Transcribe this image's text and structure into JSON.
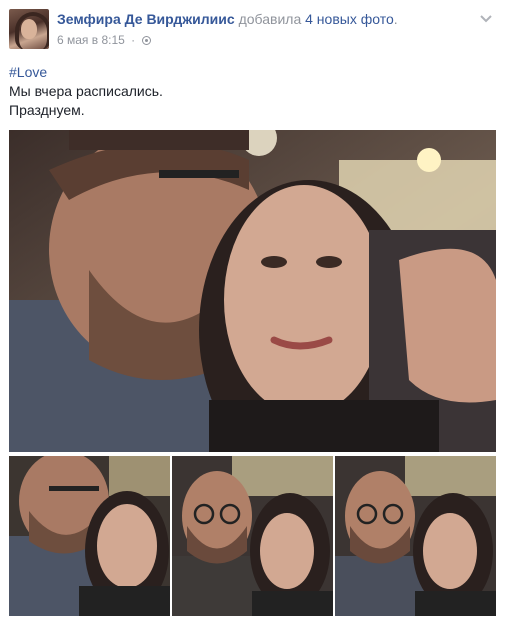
{
  "post": {
    "author": "Земфира Де Вирджилиис",
    "action": "добавила",
    "action_link": "4 новых фото",
    "action_end": ".",
    "date": "6 мая в 8:15",
    "separator": "·",
    "privacy_icon": "globe-icon",
    "menu_icon": "chevron-down-icon",
    "hashtag": "#Love",
    "lines": [
      "Мы вчера расписались.",
      "Празднуем."
    ]
  },
  "photos": {
    "count_label": "4 новых фото",
    "items": [
      "main-photo",
      "thumb-1",
      "thumb-2",
      "thumb-3"
    ]
  },
  "colors": {
    "link": "#365899",
    "meta": "#90949c",
    "text": "#1d2129"
  }
}
